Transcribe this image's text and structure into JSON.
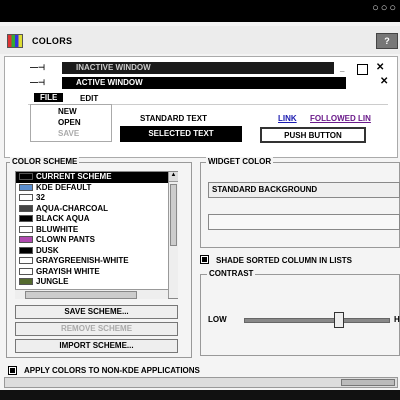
{
  "window": {
    "title": "COLORS",
    "help_label": "?",
    "dots": "○○○"
  },
  "preview": {
    "inactive_title": "INACTIVE WINDOW",
    "active_title": "ACTIVE WINDOW",
    "menu": {
      "file": "FILE",
      "edit": "EDIT"
    },
    "file_menu_items": [
      "NEW",
      "OPEN",
      "SAVE"
    ],
    "standard_text": "STANDARD TEXT",
    "selected_text": "SELECTED TEXT",
    "push_button": "PUSH BUTTON",
    "link": "LINK",
    "followed_link": "FOLLOWED LIN"
  },
  "color_scheme": {
    "label": "COLOR SCHEME",
    "schemes": [
      {
        "name": "CURRENT SCHEME",
        "color": "#000000"
      },
      {
        "name": "KDE DEFAULT",
        "color": "#5b8fd0"
      },
      {
        "name": "32",
        "color": "#ffffff"
      },
      {
        "name": "AQUA-CHARCOAL",
        "color": "#444444"
      },
      {
        "name": "BLACK AQUA",
        "color": "#000000"
      },
      {
        "name": "BLUWHITE",
        "color": "#ffffff"
      },
      {
        "name": "CLOWN PANTS",
        "color": "#b04ab0"
      },
      {
        "name": "DUSK",
        "color": "#000000"
      },
      {
        "name": "GRAYGREENISH-WHITE",
        "color": "#ffffff"
      },
      {
        "name": "GRAYISH WHITE",
        "color": "#ffffff"
      },
      {
        "name": "JUNGLE",
        "color": "#556b2f"
      }
    ],
    "selected_index": 0,
    "save_button": "SAVE SCHEME...",
    "remove_button": "REMOVE SCHEME",
    "import_button": "IMPORT SCHEME..."
  },
  "widget_color": {
    "label": "WIDGET COLOR",
    "selected_widget": "STANDARD BACKGROUND",
    "shade_sorted_label": "SHADE SORTED COLUMN IN LISTS",
    "shade_sorted_checked": true
  },
  "contrast": {
    "label": "CONTRAST",
    "low": "LOW",
    "high": "H",
    "value_fraction": 0.65
  },
  "apply_non_kde": {
    "label": "APPLY COLORS TO NON-KDE APPLICATIONS",
    "checked": true
  }
}
